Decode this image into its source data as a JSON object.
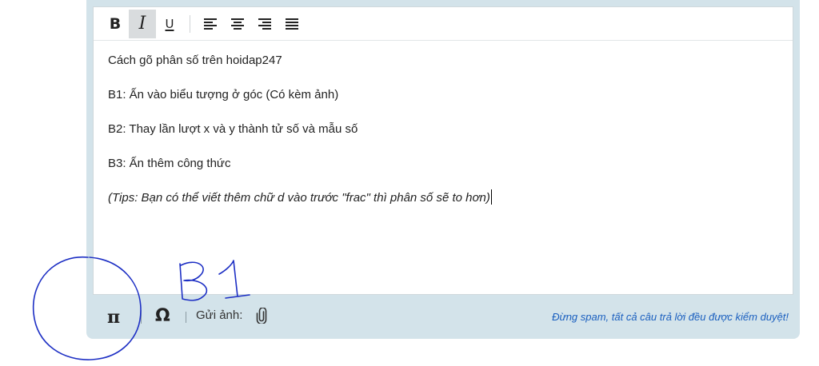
{
  "toolbar": {
    "bold_label": "B",
    "italic_label": "I",
    "underline_label": "U",
    "icons": [
      "align-left-icon",
      "align-center-icon",
      "align-right-icon",
      "align-justify-icon"
    ]
  },
  "content": {
    "paragraphs": [
      "Cách gõ phân số trên hoidap247",
      "B1: Ấn vào biểu tượng ở góc (Có kèm ảnh)",
      "B2: Thay lần lượt x và y thành tử số và mẫu số",
      "B3: Ấn thêm công thức"
    ],
    "tips": "(Tips: Bạn có thể viết thêm chữ d vào trước \"frac\" thì phân số sẽ to hơn)"
  },
  "bottom_bar": {
    "pi_label": "π",
    "omega_label": "Ω",
    "upload_label": "Gửi ảnh:",
    "notice": "Đừng spam, tất cả câu trả lời đều được kiểm duyệt!"
  },
  "colors": {
    "frame": "#d3e3ea",
    "notice": "#1a5fbf",
    "annotation": "#1d2fc4"
  }
}
